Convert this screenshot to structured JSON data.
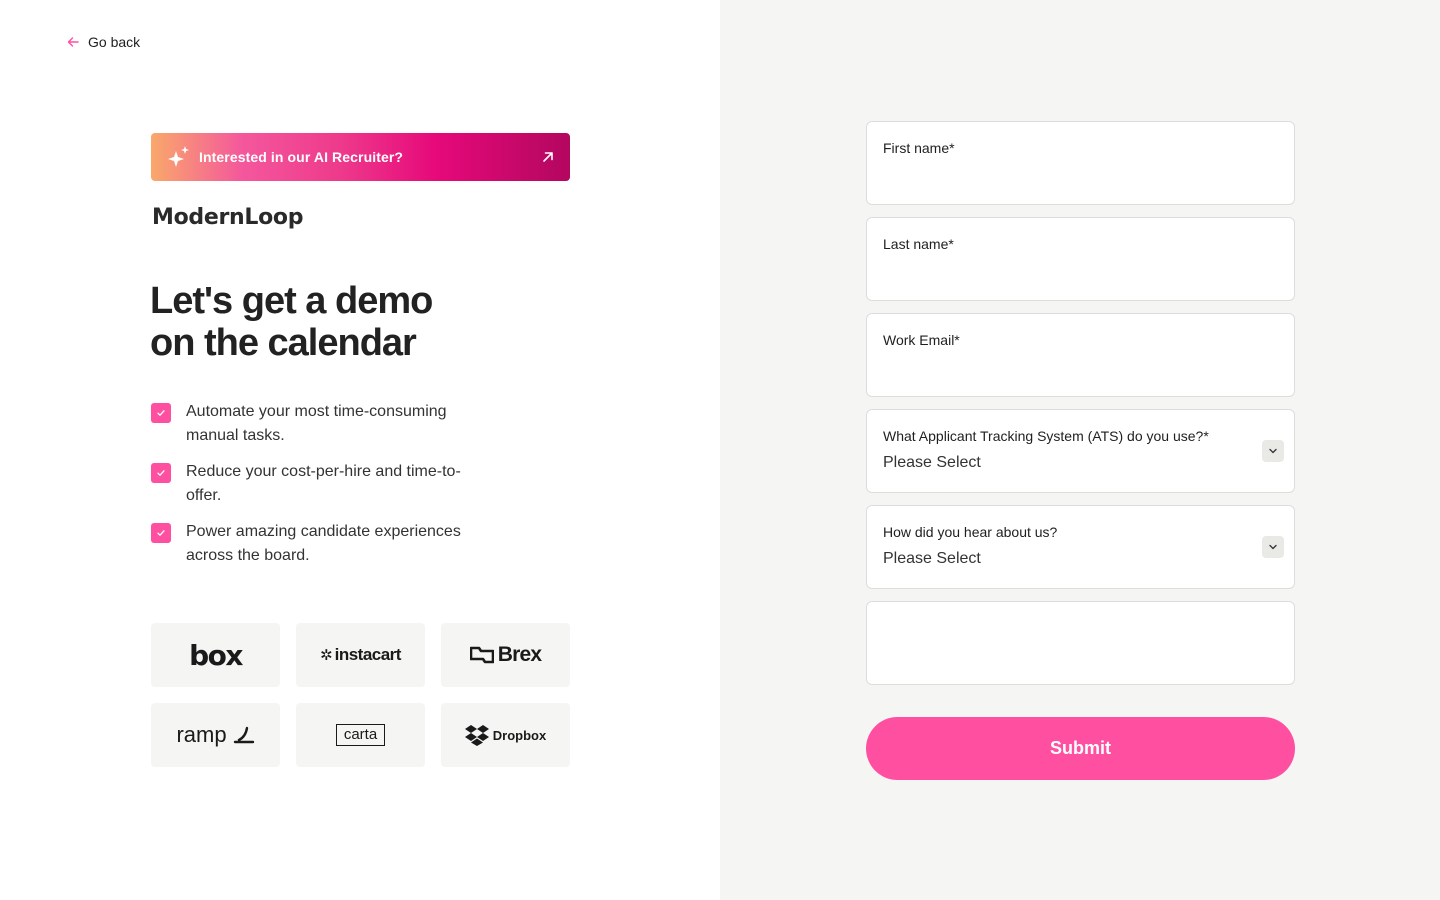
{
  "nav": {
    "back_label": "Go back"
  },
  "promo": {
    "text": "Interested in our AI Recruiter?"
  },
  "brand": {
    "name": "ModernLoop"
  },
  "hero": {
    "line1": "Let's get a demo",
    "line2": "on the calendar"
  },
  "benefits": [
    "Automate your most time-consuming manual tasks.",
    "Reduce your cost-per-hire and time-to-offer.",
    "Power amazing candidate experiences across the board."
  ],
  "customers": {
    "box": "box",
    "instacart": "instacart",
    "brex": "Brex",
    "ramp": "ramp",
    "carta": "carta",
    "dropbox": "Dropbox"
  },
  "form": {
    "first_name_label": "First name*",
    "last_name_label": "Last name*",
    "email_label": "Work Email*",
    "ats_label": "What Applicant Tracking System (ATS) do you use?*",
    "ats_value": "Please Select",
    "source_label": "How did you hear about us?",
    "source_value": "Please Select",
    "submit_label": "Submit"
  },
  "colors": {
    "accent": "#ff4fa0",
    "panel": "#f5f5f3"
  }
}
